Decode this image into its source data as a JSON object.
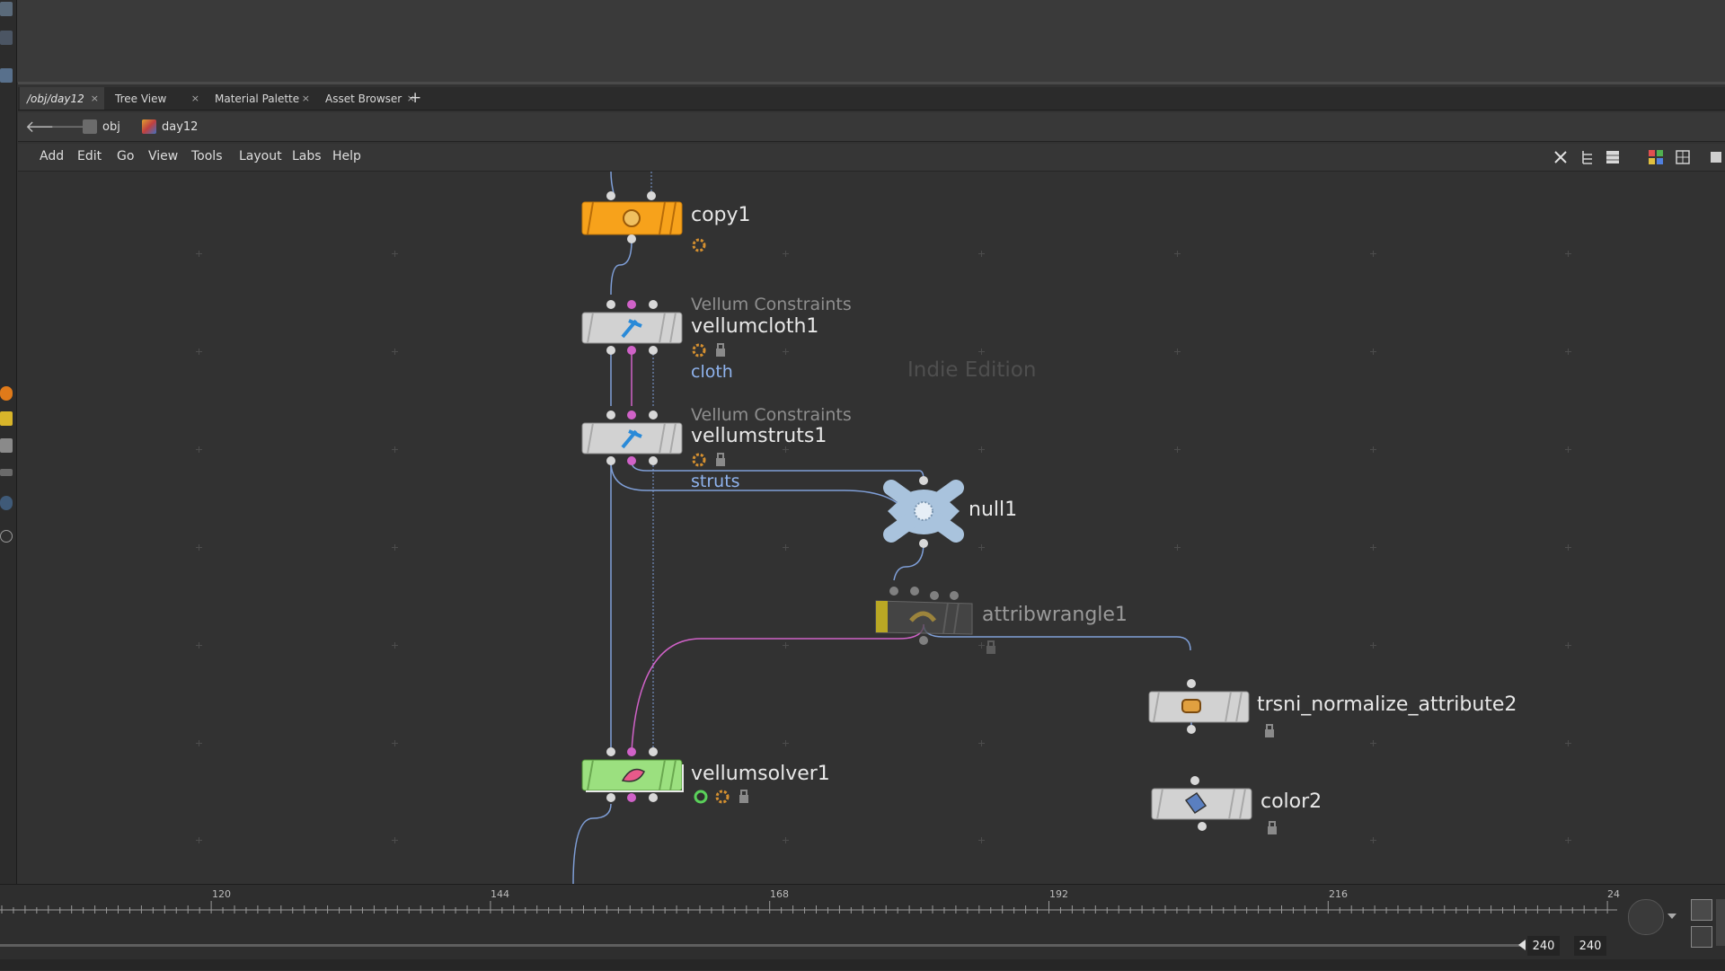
{
  "tabs": [
    {
      "label": "/obj/day12",
      "active": true
    },
    {
      "label": "Tree View",
      "active": false
    },
    {
      "label": "Material Palette",
      "active": false
    },
    {
      "label": "Asset Browser",
      "active": false
    }
  ],
  "tab_close_glyph": "×",
  "tab_add_glyph": "+",
  "path": [
    {
      "label": "obj",
      "icon": "obj-network-icon"
    },
    {
      "label": "day12",
      "icon": "geometry-icon"
    }
  ],
  "menu": [
    "Add",
    "Edit",
    "Go",
    "View",
    "Tools",
    "Layout",
    "Labs",
    "Help"
  ],
  "watermark": "Indie Edition",
  "nodes": {
    "copy1": {
      "name": "copy1",
      "color": "#f7a21b"
    },
    "vellumcloth1": {
      "type": "Vellum Constraints",
      "name": "vellumcloth1",
      "tag": "cloth"
    },
    "vellumstruts1": {
      "type": "Vellum Constraints",
      "name": "vellumstruts1",
      "tag": "struts"
    },
    "null1": {
      "name": "null1"
    },
    "attribwrangle1": {
      "name": "attribwrangle1"
    },
    "normalize": {
      "name": "trsni_normalize_attribute2"
    },
    "color2": {
      "name": "color2"
    },
    "vellumsolver1": {
      "name": "vellumsolver1",
      "color": "#9be07f"
    }
  },
  "timeline": {
    "ticks": [
      "120",
      "144",
      "168",
      "192",
      "216",
      "24"
    ],
    "end_frame": "240",
    "end_frame_2": "240"
  },
  "colors": {
    "wire_blue": "#7f9fd8",
    "wire_pink": "#d062c8",
    "node_grey": "#d2d2d2",
    "flag_orange": "#d59030",
    "tag_blue": "#8fb3ee"
  }
}
